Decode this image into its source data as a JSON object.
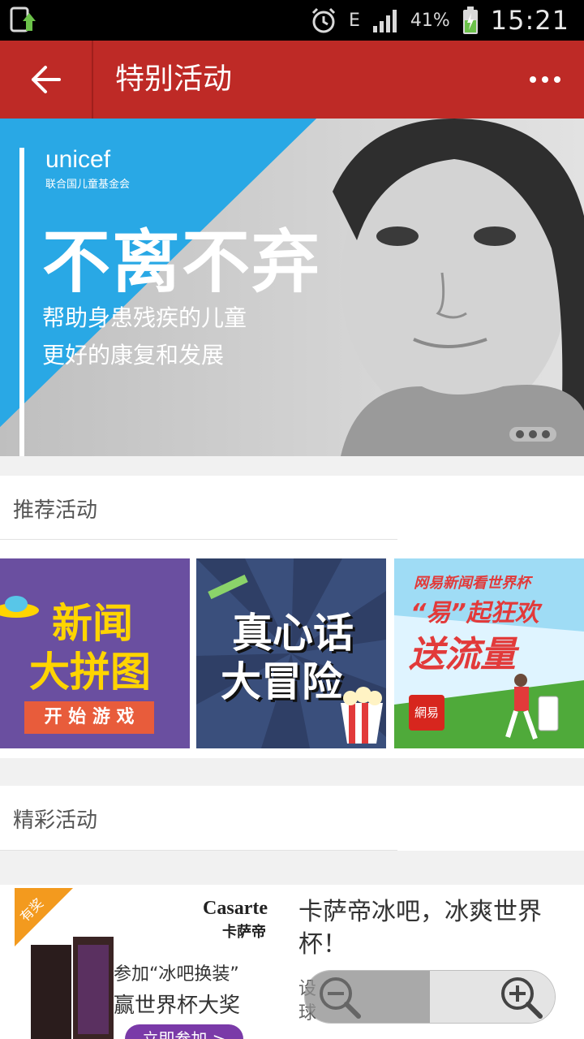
{
  "status_bar": {
    "network": "E",
    "battery": "41%",
    "time": "15:21"
  },
  "header": {
    "title": "特别活动"
  },
  "banner": {
    "brand": "unicef",
    "brand_sub": "联合国儿童基金会",
    "headline": "不离不弃",
    "line1": "帮助身患残疾的儿童",
    "line2": "更好的康复和发展"
  },
  "recommended": {
    "title": "推荐活动",
    "tiles": [
      {
        "line1": "新闻",
        "line2": "大拼图",
        "cta": "开 始 游 戏"
      },
      {
        "line1": "真心话",
        "line2": "大冒险"
      },
      {
        "line1": "网易新闻看世界杯",
        "line2": "“易”起狂欢",
        "line3": "送流量",
        "logo": "網易"
      }
    ]
  },
  "featured": {
    "title": "精彩活动",
    "card": {
      "badge": "有奖",
      "ad_brand": "Casarte",
      "ad_brand_cn": "卡萨帝",
      "ad_line1": "参加“冰吧换装”",
      "ad_line2": "赢世界杯大奖",
      "ad_button": "立即参加 >",
      "title": "卡萨帝冰吧，冰爽世界杯！",
      "sub1": "设",
      "sub2": "球"
    }
  },
  "colors": {
    "header": "#be2a26",
    "banner_blue": "#29a8e5",
    "tile1_bg": "#6a4fa0",
    "tile2_bg": "#3a4f7c",
    "tile_accent": "#ffd400"
  }
}
